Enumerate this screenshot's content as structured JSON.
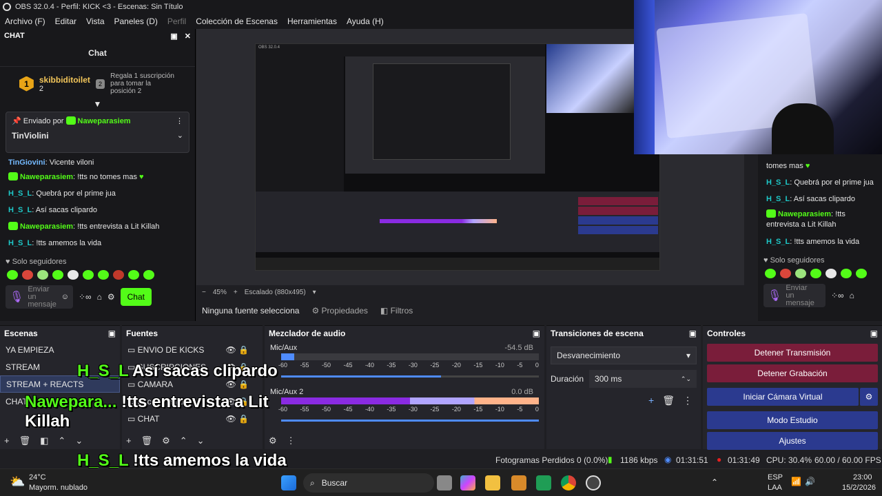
{
  "window": {
    "title": "OBS 32.0.4 - Perfil: KICK <3 - Escenas: Sin Título"
  },
  "menu": [
    "Archivo (F)",
    "Editar",
    "Vista",
    "Paneles (D)",
    "Perfil",
    "Colección de Escenas",
    "Herramientas",
    "Ayuda (H)"
  ],
  "chat": {
    "dock_title": "CHAT",
    "header": "Chat",
    "top_user": "skibbiditoilet",
    "top_rank": "1",
    "top_count": "2",
    "gift_rank": "2",
    "gift_text": "Regala 1 suscripción para tomar la posición 2",
    "pinned_by": "Enviado por",
    "pinned_user": "Naweparasiem",
    "pinned_text": "TinViolini",
    "messages": [
      {
        "user": "TinGiovini",
        "text": ": Vicente viloni"
      },
      {
        "user": "Naweparasiem",
        "text": ": !tts no tomes mas"
      },
      {
        "user": "H_S_L",
        "text": ": Quebrá por el prime jua"
      },
      {
        "user": "H_S_L",
        "text": ": Así sacas clipardo"
      },
      {
        "user": "Naweparasiem",
        "text": ": !tts entrevista a Lit Killah"
      },
      {
        "user": "H_S_L",
        "text": ": !tts amemos la vida"
      }
    ],
    "followers_only": "Solo seguidores",
    "input_placeholder": "Enviar un mensaje",
    "send_label": "Chat"
  },
  "right_chat": {
    "messages": [
      {
        "user": "",
        "text": "tomes mas"
      },
      {
        "user": "H_S_L",
        "text": ": Quebrá por el prime jua"
      },
      {
        "user": "H_S_L",
        "text": ": Así sacas clipardo"
      },
      {
        "user": "Naweparasiem",
        "text": ": !tts entrevista a Lit Killah"
      },
      {
        "user": "H_S_L",
        "text": ": !tts amemos la vida"
      }
    ],
    "followers_only": "Solo seguidores",
    "input_placeholder": "Enviar un mensaje"
  },
  "preview": {
    "zoom": "45%",
    "scale": "Escalado (880x495)"
  },
  "context": {
    "no_source": "Ninguna fuente selecciona",
    "properties": "Propiedades",
    "filters": "Filtros"
  },
  "scenes": {
    "title": "Escenas",
    "items": [
      "YA EMPIEZA",
      "STREAM",
      "STREAM + REACTS",
      "CHAT"
    ]
  },
  "sources": {
    "title": "Fuentes",
    "items": [
      "ENVIO DE KICKS",
      "SUSCRIPCIONES",
      "CAMARA",
      "Escena anterior",
      "CHAT"
    ]
  },
  "mixer": {
    "title": "Mezclador de audio",
    "channels": [
      {
        "name": "Mic/Aux",
        "db": "-54.5 dB",
        "level": 0.05,
        "volume": 0.62
      },
      {
        "name": "Mic/Aux 2",
        "db": "0.0 dB",
        "level": 1.0,
        "volume": 1.0
      }
    ],
    "scale": [
      "-60",
      "-55",
      "-50",
      "-45",
      "-40",
      "-35",
      "-30",
      "-25",
      "-20",
      "-15",
      "-10",
      "-5",
      "0"
    ]
  },
  "transitions": {
    "title": "Transiciones de escena",
    "selected": "Desvanecimiento",
    "duration_label": "Duración",
    "duration": "300 ms"
  },
  "controls": {
    "title": "Controles",
    "stop_stream": "Detener Transmisión",
    "stop_record": "Detener Grabación",
    "virtual_cam": "Iniciar Cámara Virtual",
    "studio": "Modo Estudio",
    "settings": "Ajustes"
  },
  "statusbar": {
    "dropped": "Fotogramas Perdidos 0 (0.0%)",
    "kbps": "1186 kbps",
    "stream_time": "01:31:51",
    "rec_time": "01:31:49",
    "cpu": "CPU: 30.4%",
    "fps": "60.00 / 60.00 FPS"
  },
  "overlay": [
    {
      "user": "H_S_L",
      "text": "Así sacas clipardo"
    },
    {
      "user": "Naweparа...",
      "text": "!tts entrevista a Lit Killah"
    },
    {
      "user": "H_S_L",
      "text": "!tts amemos la vida"
    }
  ],
  "taskbar": {
    "temp": "24°C",
    "weather": "Mayorm. nublado",
    "search": "Buscar",
    "lang1": "ESP",
    "lang2": "LAA",
    "time": "23:00",
    "date": "15/2/2026"
  },
  "colors": {
    "kick_green": "#53fc18",
    "stop_red": "#7a1d3a",
    "ctrl_blue": "#2b3a8f",
    "bg": "#1f1f23"
  }
}
